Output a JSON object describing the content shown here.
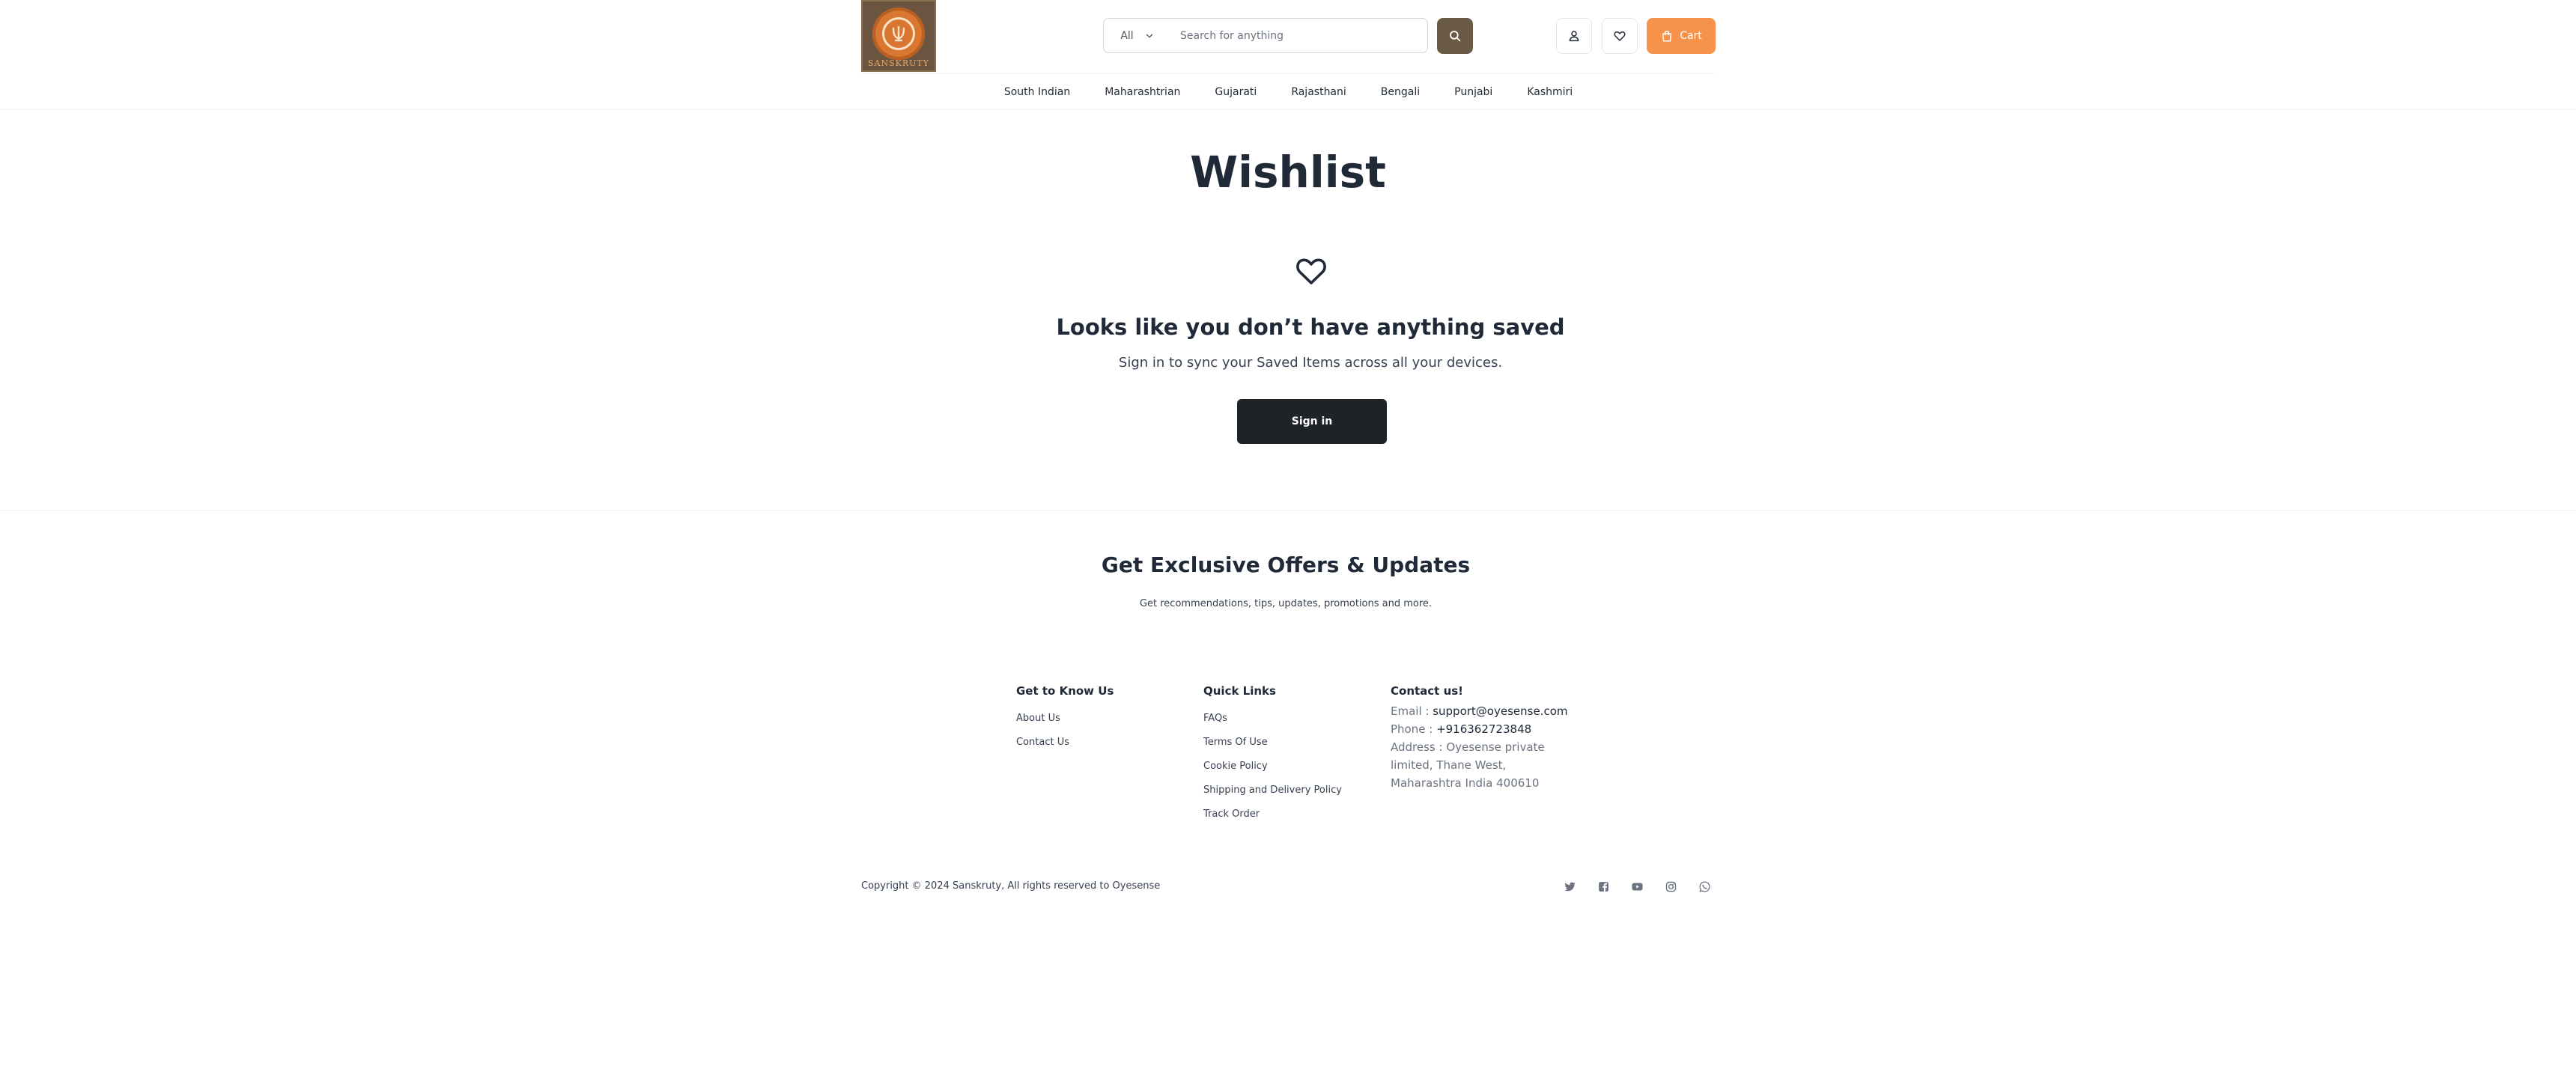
{
  "header": {
    "logo_text": "SANSKRUTY",
    "search": {
      "category": "All",
      "placeholder": "Search for anything"
    },
    "cart_label": "Cart",
    "colors": {
      "brand_brown": "#6b5a45",
      "cart_orange": "#f7924b"
    }
  },
  "nav": {
    "items": [
      "South Indian",
      "Maharashtrian",
      "Gujarati",
      "Rajasthani",
      "Bengali",
      "Punjabi",
      "Kashmiri"
    ]
  },
  "main": {
    "title": "Wishlist",
    "empty_heading": "Looks like you don’t have anything saved",
    "empty_sub": "Sign in to sync your Saved Items across all your devices.",
    "signin_label": "Sign in"
  },
  "newsletter": {
    "title": "Get Exclusive Offers & Updates",
    "subtitle": "Get recommendations, tips, updates, promotions and more."
  },
  "footer": {
    "know_us": {
      "title": "Get to Know Us",
      "links": [
        "About Us",
        "Contact Us"
      ]
    },
    "quick_links": {
      "title": "Quick Links",
      "links": [
        "FAQs",
        "Terms Of Use",
        "Cookie Policy",
        "Shipping and Delivery Policy",
        "Track Order"
      ]
    },
    "contact": {
      "title": "Contact us!",
      "email_label": "Email : ",
      "email": "support@oyesense.com",
      "phone_label": "Phone : ",
      "phone": "+916362723848",
      "address_lines": [
        "Address : Oyesense private",
        "limited, Thane West,",
        "Maharashtra India 400610"
      ]
    },
    "copyright": "Copyright © 2024 Sanskruty, All rights reserved to Oyesense",
    "socials": [
      "twitter-icon",
      "facebook-icon",
      "youtube-icon",
      "instagram-icon",
      "whatsapp-icon"
    ]
  }
}
